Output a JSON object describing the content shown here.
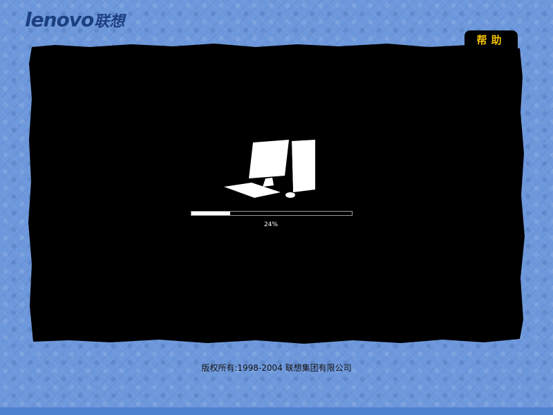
{
  "brand": {
    "logo_latin": "lenovo",
    "logo_chinese": "联想",
    "color": "#1c3f80"
  },
  "help": {
    "label": "帮助",
    "color": "#f3c200"
  },
  "loading": {
    "progress_fraction": 0.24,
    "percent_text": "24%",
    "icon": "computer-icon"
  },
  "footer": {
    "copyright": "版权所有:1998-2004 联想集团有限公司"
  },
  "colors": {
    "background": "#6e98dc",
    "panel": "#000000",
    "accent": "#f3c200"
  }
}
